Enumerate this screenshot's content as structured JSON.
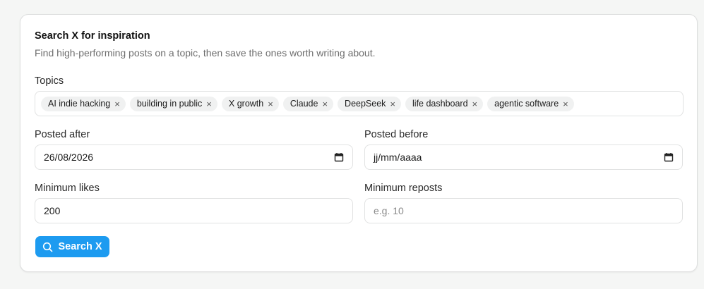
{
  "card": {
    "title": "Search X for inspiration",
    "subtitle": "Find high-performing posts on a topic, then save the ones worth writing about."
  },
  "topics": {
    "label": "Topics",
    "chips": [
      {
        "label": "AI indie hacking",
        "remove": "×"
      },
      {
        "label": "building in public",
        "remove": "×"
      },
      {
        "label": "X growth",
        "remove": "×"
      },
      {
        "label": "Claude",
        "remove": "×"
      },
      {
        "label": "DeepSeek",
        "remove": "×"
      },
      {
        "label": "life dashboard",
        "remove": "×"
      },
      {
        "label": "agentic software",
        "remove": "×"
      }
    ]
  },
  "posted_after": {
    "label": "Posted after",
    "value": "26/08/2026"
  },
  "posted_before": {
    "label": "Posted before",
    "value": "jj/mm/aaaa"
  },
  "min_likes": {
    "label": "Minimum likes",
    "value": "200"
  },
  "min_reposts": {
    "label": "Minimum reposts",
    "placeholder": "e.g. 10"
  },
  "search_button": {
    "label": "Search X",
    "icon": "search-icon",
    "color": "#1d9bf0"
  }
}
